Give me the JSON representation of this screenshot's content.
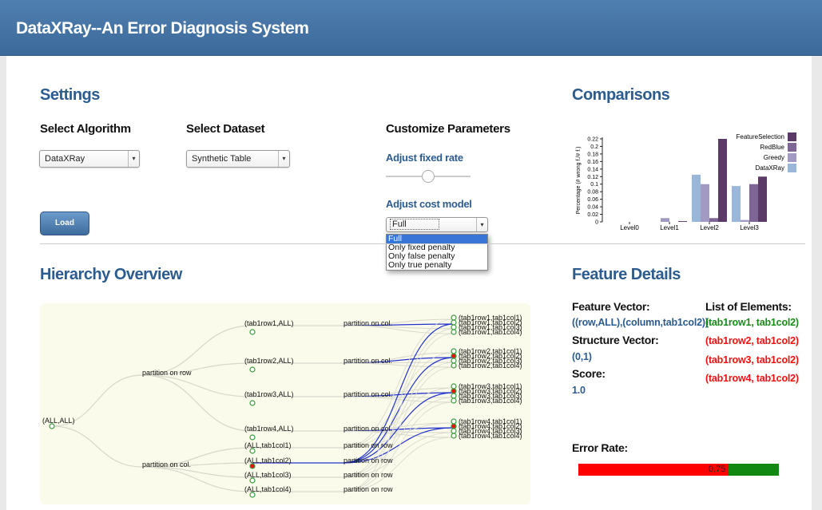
{
  "header": {
    "title": "DataXRay--An Error Diagnosis System"
  },
  "settings": {
    "title": "Settings",
    "select_algorithm_label": "Select Algorithm",
    "algorithm_value": "DataXRay",
    "select_dataset_label": "Select Dataset",
    "dataset_value": "Synthetic Table",
    "customize_label": "Customize Parameters",
    "fixed_rate_label": "Adjust fixed rate",
    "fixed_rate_value": 0.5,
    "cost_model_label": "Adjust cost model",
    "cost_model_value": "Full",
    "cost_model_options": [
      "Full",
      "Only fixed penalty",
      "Only false penalty",
      "Only true penalty"
    ],
    "cost_model_selected_index": 0,
    "load_label": "Load"
  },
  "comparisons": {
    "title": "Comparisons",
    "chart_data": {
      "type": "bar",
      "ylabel": "Percentage (# wrong f./# f.)",
      "ylim": [
        0,
        0.22
      ],
      "yticks": [
        "0",
        "0.02",
        "0.04",
        "0.06",
        "0.08",
        "0.1",
        "0.12",
        "0.14",
        "0.16",
        "0.18",
        "0.2",
        "0.22"
      ],
      "categories": [
        "Level0",
        "Level1",
        "Level2",
        "Level3"
      ],
      "legend_position": "top-right",
      "series": [
        {
          "name": "FeatureSelection",
          "color": "#5b3a68",
          "values": [
            0,
            0.002,
            0.22,
            0.12
          ]
        },
        {
          "name": "RedBlue",
          "color": "#7d6596",
          "values": [
            0,
            0,
            0.01,
            0.1
          ]
        },
        {
          "name": "Greedy",
          "color": "#a39ac4",
          "values": [
            0,
            0.01,
            0.1,
            0.005
          ]
        },
        {
          "name": "DataXRay",
          "color": "#9ab7d9",
          "values": [
            0,
            0,
            0.125,
            0.095
          ]
        }
      ]
    }
  },
  "hierarchy": {
    "title": "Hierarchy Overview",
    "root": "(ALL,ALL)",
    "partition_row": "partition on row",
    "partition_col": "partition on col.",
    "row_nodes": [
      "(tab1row1,ALL)",
      "(tab1row2,ALL)",
      "(tab1row3,ALL)",
      "(tab1row4,ALL)"
    ],
    "col_nodes": [
      "(ALL,tab1col1)",
      "(ALL,tab1col2)",
      "(ALL,tab1col3)",
      "(ALL,tab1col4)"
    ],
    "row_partition_label": "partition on col.",
    "col_partition_label": "partition on row",
    "leaves": [
      [
        "(tab1row1,tab1col1)",
        "(tab1row1,tab1col2)",
        "(tab1row1,tab1col3)",
        "(tab1row1,tab1col4)"
      ],
      [
        "(tab1row2,tab1col1)",
        "(tab1row2,tab1col2)",
        "(tab1row2,tab1col3)",
        "(tab1row2,tab1col4)"
      ],
      [
        "(tab1row3,tab1col1)",
        "(tab1row3,tab1col2)",
        "(tab1row3,tab1col3)",
        "(tab1row3,tab1col4)"
      ],
      [
        "(tab1row4,tab1col1)",
        "(tab1row4,tab1col2)",
        "(tab1row4,tab1col3)",
        "(tab1row4,tab1col4)"
      ]
    ]
  },
  "feature_details": {
    "title": "Feature Details",
    "feature_vector_label": "Feature Vector:",
    "feature_vector_value": "((row,ALL),(column,tab1col2))",
    "structure_vector_label": "Structure Vector:",
    "structure_vector_value": "(0,1)",
    "score_label": "Score:",
    "score_value": "1.0",
    "list_label": "List of Elements:",
    "elements": [
      {
        "text": "(tab1row1, tab1col2)",
        "color": "#1a8a1a"
      },
      {
        "text": "(tab1row2, tab1col2)",
        "color": "#ee1111"
      },
      {
        "text": "(tab1row3, tab1col2)",
        "color": "#ee1111"
      },
      {
        "text": "(tab1row4, tab1col2)",
        "color": "#ee1111"
      }
    ],
    "error_rate_label": "Error Rate:",
    "error_rate_value": "0.75",
    "error_rate": 0.75
  }
}
